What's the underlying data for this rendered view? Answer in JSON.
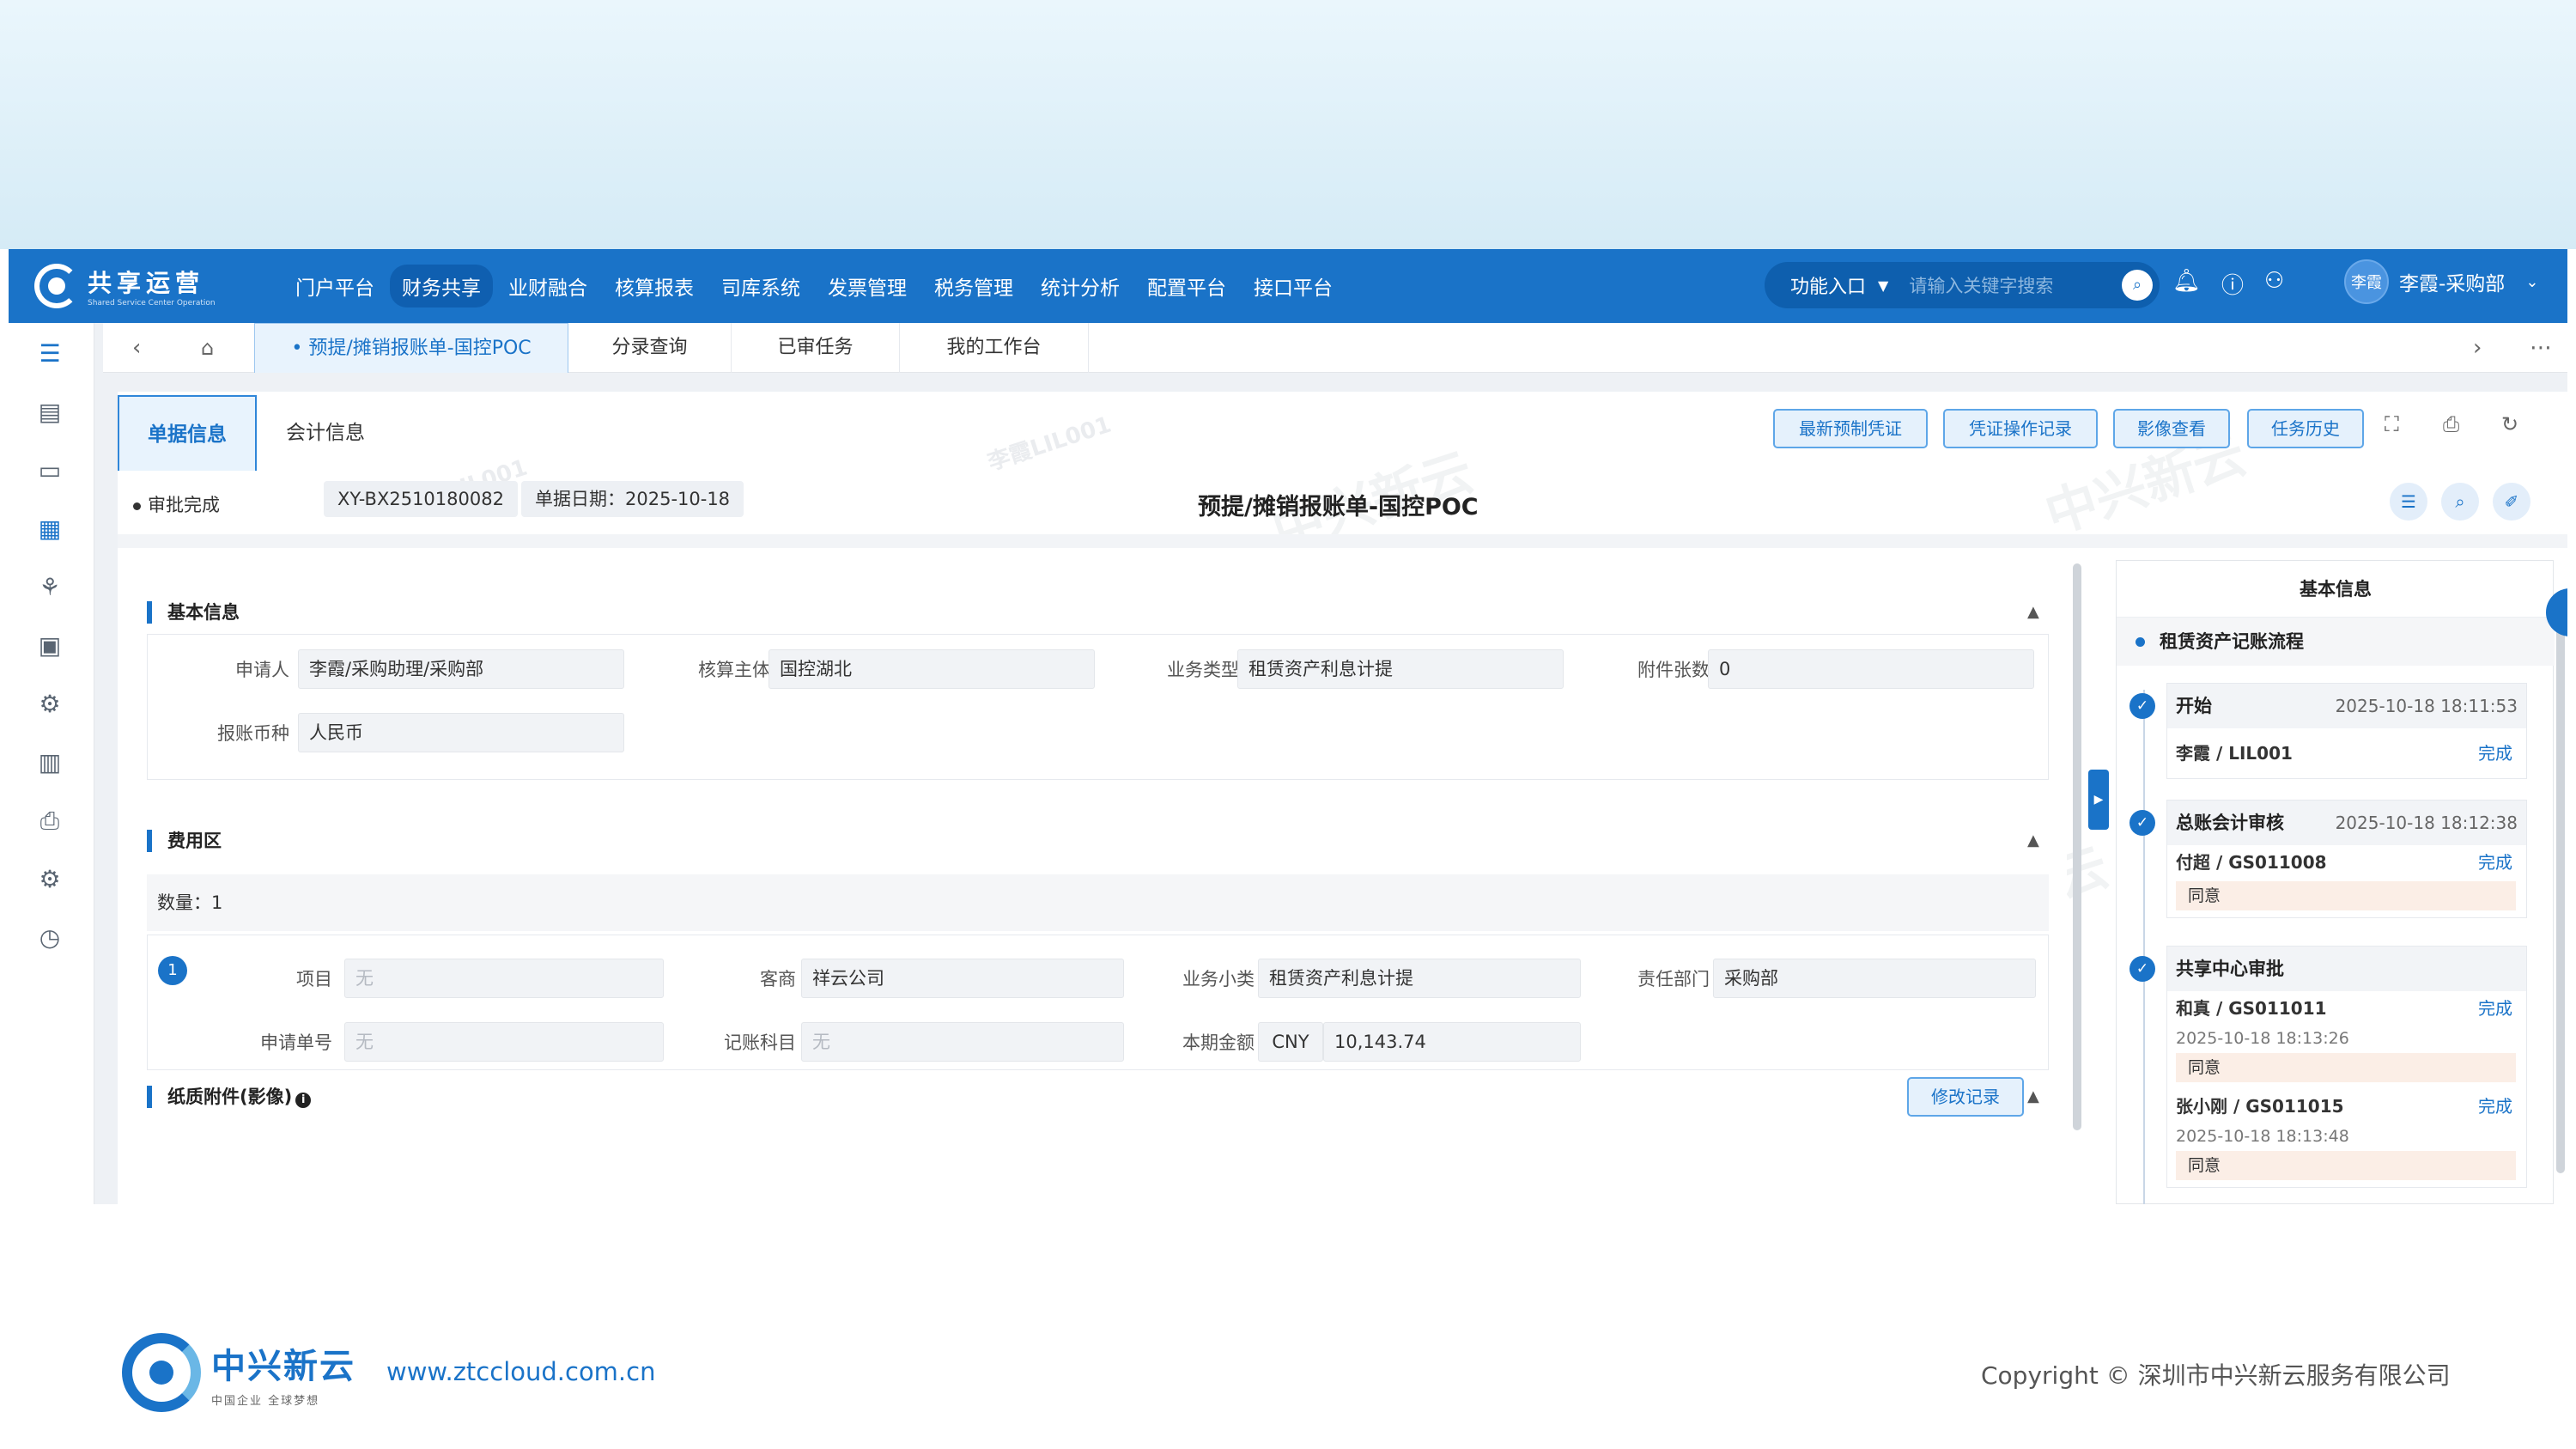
{
  "app": {
    "title": "共享运营",
    "subtitle": "Shared Service Center Operation"
  },
  "nav": [
    "门户平台",
    "财务共享",
    "业财融合",
    "核算报表",
    "司库系统",
    "发票管理",
    "税务管理",
    "统计分析",
    "配置平台",
    "接口平台"
  ],
  "func": {
    "label": "功能入口",
    "placeholder": "请输入关键字搜索"
  },
  "user": {
    "avatar": "李霞",
    "name": "李霞-采购部"
  },
  "tabs": [
    "预提/摊销报账单-国控POC",
    "分录查询",
    "已审任务",
    "我的工作台"
  ],
  "header_tabs": [
    "单据信息",
    "会计信息"
  ],
  "buttons": [
    "最新预制凭证",
    "凭证操作记录",
    "影像查看",
    "任务历史"
  ],
  "doc": {
    "status": "审批完成",
    "number": "XY-BX2510180082",
    "date": "单据日期：2025-10-18",
    "title": "预提/摊销报账单-国控POC"
  },
  "basic": {
    "title": "基本信息",
    "fields": [
      {
        "label": "申请人",
        "value": "李霞/采购助理/采购部"
      },
      {
        "label": "核算主体",
        "value": "国控湖北"
      },
      {
        "label": "业务类型",
        "value": "租赁资产利息计提"
      },
      {
        "label": "附件张数",
        "value": "0"
      },
      {
        "label": "报账币种",
        "value": "人民币"
      }
    ]
  },
  "expense": {
    "title": "费用区",
    "count": "数量：1",
    "row_no": "1",
    "fields": [
      {
        "label": "项目",
        "value": "无"
      },
      {
        "label": "客商",
        "value": "祥云公司"
      },
      {
        "label": "业务小类",
        "value": "租赁资产利息计提"
      },
      {
        "label": "责任部门",
        "value": "采购部"
      },
      {
        "label": "申请单号",
        "value": "无"
      },
      {
        "label": "记账科目",
        "value": "无"
      },
      {
        "label": "本期金额",
        "currency": "CNY",
        "value": "10,143.74"
      }
    ]
  },
  "paper": {
    "title": "纸质附件(影像)",
    "button": "修改记录"
  },
  "side": {
    "title": "基本信息",
    "flow": "租赁资产记账流程",
    "steps": [
      {
        "name": "开始",
        "time": "2025-10-18 18:11:53",
        "who": "李霞 / LIL001",
        "status": "完成"
      },
      {
        "name": "总账会计审核",
        "time": "2025-10-18 18:12:38",
        "who": "付超 / GS011008",
        "status": "完成",
        "comment": "同意"
      },
      {
        "name": "共享中心审批",
        "approvers": [
          {
            "who": "和真 / GS011011",
            "status": "完成",
            "time": "2025-10-18 18:13:26",
            "comment": "同意"
          },
          {
            "who": "张小刚 / GS011015",
            "status": "完成",
            "time": "2025-10-18 18:13:48",
            "comment": "同意"
          }
        ]
      }
    ]
  },
  "watermark": {
    "brand": "中兴新云",
    "user": "李霞LIL001"
  },
  "footer": {
    "brand": "中兴新云",
    "slogan": "中国企业 全球梦想",
    "site": "www.ztccloud.com.cn",
    "copyright": "Copyright © 深圳市中兴新云服务有限公司"
  }
}
